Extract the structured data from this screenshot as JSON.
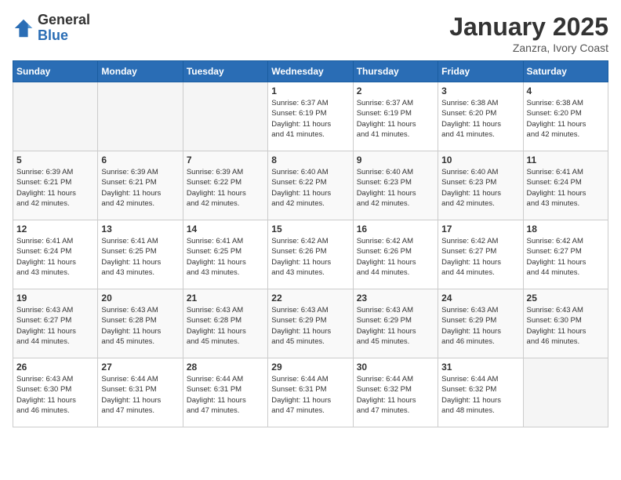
{
  "logo": {
    "general": "General",
    "blue": "Blue"
  },
  "title": "January 2025",
  "location": "Zanzra, Ivory Coast",
  "days_of_week": [
    "Sunday",
    "Monday",
    "Tuesday",
    "Wednesday",
    "Thursday",
    "Friday",
    "Saturday"
  ],
  "weeks": [
    [
      {
        "day": "",
        "info": ""
      },
      {
        "day": "",
        "info": ""
      },
      {
        "day": "",
        "info": ""
      },
      {
        "day": "1",
        "info": "Sunrise: 6:37 AM\nSunset: 6:19 PM\nDaylight: 11 hours\nand 41 minutes."
      },
      {
        "day": "2",
        "info": "Sunrise: 6:37 AM\nSunset: 6:19 PM\nDaylight: 11 hours\nand 41 minutes."
      },
      {
        "day": "3",
        "info": "Sunrise: 6:38 AM\nSunset: 6:20 PM\nDaylight: 11 hours\nand 41 minutes."
      },
      {
        "day": "4",
        "info": "Sunrise: 6:38 AM\nSunset: 6:20 PM\nDaylight: 11 hours\nand 42 minutes."
      }
    ],
    [
      {
        "day": "5",
        "info": "Sunrise: 6:39 AM\nSunset: 6:21 PM\nDaylight: 11 hours\nand 42 minutes."
      },
      {
        "day": "6",
        "info": "Sunrise: 6:39 AM\nSunset: 6:21 PM\nDaylight: 11 hours\nand 42 minutes."
      },
      {
        "day": "7",
        "info": "Sunrise: 6:39 AM\nSunset: 6:22 PM\nDaylight: 11 hours\nand 42 minutes."
      },
      {
        "day": "8",
        "info": "Sunrise: 6:40 AM\nSunset: 6:22 PM\nDaylight: 11 hours\nand 42 minutes."
      },
      {
        "day": "9",
        "info": "Sunrise: 6:40 AM\nSunset: 6:23 PM\nDaylight: 11 hours\nand 42 minutes."
      },
      {
        "day": "10",
        "info": "Sunrise: 6:40 AM\nSunset: 6:23 PM\nDaylight: 11 hours\nand 42 minutes."
      },
      {
        "day": "11",
        "info": "Sunrise: 6:41 AM\nSunset: 6:24 PM\nDaylight: 11 hours\nand 43 minutes."
      }
    ],
    [
      {
        "day": "12",
        "info": "Sunrise: 6:41 AM\nSunset: 6:24 PM\nDaylight: 11 hours\nand 43 minutes."
      },
      {
        "day": "13",
        "info": "Sunrise: 6:41 AM\nSunset: 6:25 PM\nDaylight: 11 hours\nand 43 minutes."
      },
      {
        "day": "14",
        "info": "Sunrise: 6:41 AM\nSunset: 6:25 PM\nDaylight: 11 hours\nand 43 minutes."
      },
      {
        "day": "15",
        "info": "Sunrise: 6:42 AM\nSunset: 6:26 PM\nDaylight: 11 hours\nand 43 minutes."
      },
      {
        "day": "16",
        "info": "Sunrise: 6:42 AM\nSunset: 6:26 PM\nDaylight: 11 hours\nand 44 minutes."
      },
      {
        "day": "17",
        "info": "Sunrise: 6:42 AM\nSunset: 6:27 PM\nDaylight: 11 hours\nand 44 minutes."
      },
      {
        "day": "18",
        "info": "Sunrise: 6:42 AM\nSunset: 6:27 PM\nDaylight: 11 hours\nand 44 minutes."
      }
    ],
    [
      {
        "day": "19",
        "info": "Sunrise: 6:43 AM\nSunset: 6:27 PM\nDaylight: 11 hours\nand 44 minutes."
      },
      {
        "day": "20",
        "info": "Sunrise: 6:43 AM\nSunset: 6:28 PM\nDaylight: 11 hours\nand 45 minutes."
      },
      {
        "day": "21",
        "info": "Sunrise: 6:43 AM\nSunset: 6:28 PM\nDaylight: 11 hours\nand 45 minutes."
      },
      {
        "day": "22",
        "info": "Sunrise: 6:43 AM\nSunset: 6:29 PM\nDaylight: 11 hours\nand 45 minutes."
      },
      {
        "day": "23",
        "info": "Sunrise: 6:43 AM\nSunset: 6:29 PM\nDaylight: 11 hours\nand 45 minutes."
      },
      {
        "day": "24",
        "info": "Sunrise: 6:43 AM\nSunset: 6:29 PM\nDaylight: 11 hours\nand 46 minutes."
      },
      {
        "day": "25",
        "info": "Sunrise: 6:43 AM\nSunset: 6:30 PM\nDaylight: 11 hours\nand 46 minutes."
      }
    ],
    [
      {
        "day": "26",
        "info": "Sunrise: 6:43 AM\nSunset: 6:30 PM\nDaylight: 11 hours\nand 46 minutes."
      },
      {
        "day": "27",
        "info": "Sunrise: 6:44 AM\nSunset: 6:31 PM\nDaylight: 11 hours\nand 47 minutes."
      },
      {
        "day": "28",
        "info": "Sunrise: 6:44 AM\nSunset: 6:31 PM\nDaylight: 11 hours\nand 47 minutes."
      },
      {
        "day": "29",
        "info": "Sunrise: 6:44 AM\nSunset: 6:31 PM\nDaylight: 11 hours\nand 47 minutes."
      },
      {
        "day": "30",
        "info": "Sunrise: 6:44 AM\nSunset: 6:32 PM\nDaylight: 11 hours\nand 47 minutes."
      },
      {
        "day": "31",
        "info": "Sunrise: 6:44 AM\nSunset: 6:32 PM\nDaylight: 11 hours\nand 48 minutes."
      },
      {
        "day": "",
        "info": ""
      }
    ]
  ]
}
